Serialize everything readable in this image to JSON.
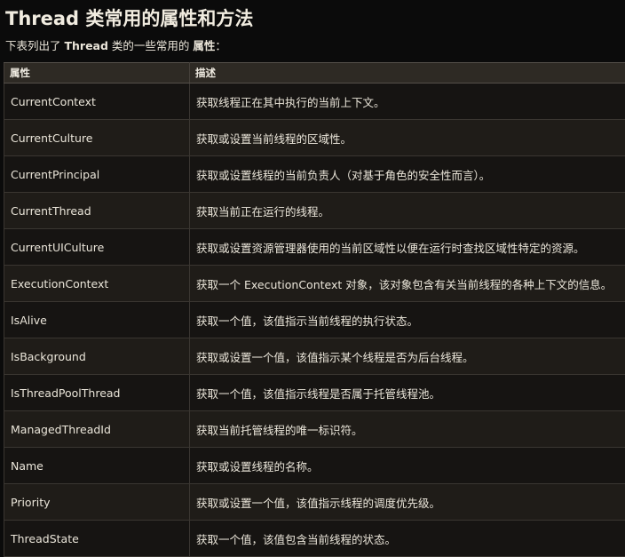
{
  "page": {
    "title": "Thread 类常用的属性和方法",
    "intro_prefix": "下表列出了 ",
    "intro_class": "Thread",
    "intro_middle": " 类的一些常用的 ",
    "intro_bold": "属性",
    "intro_suffix": "："
  },
  "table": {
    "headers": [
      "属性",
      "描述"
    ],
    "rows": [
      {
        "name": "CurrentContext",
        "desc": "获取线程正在其中执行的当前上下文。"
      },
      {
        "name": "CurrentCulture",
        "desc": "获取或设置当前线程的区域性。"
      },
      {
        "name": "CurrentPrincipal",
        "desc": "获取或设置线程的当前负责人（对基于角色的安全性而言）。"
      },
      {
        "name": "CurrentThread",
        "desc": "获取当前正在运行的线程。"
      },
      {
        "name": "CurrentUICulture",
        "desc": "获取或设置资源管理器使用的当前区域性以便在运行时查找区域性特定的资源。"
      },
      {
        "name": "ExecutionContext",
        "desc": "获取一个 ExecutionContext 对象，该对象包含有关当前线程的各种上下文的信息。"
      },
      {
        "name": "IsAlive",
        "desc": "获取一个值，该值指示当前线程的执行状态。"
      },
      {
        "name": "IsBackground",
        "desc": "获取或设置一个值，该值指示某个线程是否为后台线程。"
      },
      {
        "name": "IsThreadPoolThread",
        "desc": "获取一个值，该值指示线程是否属于托管线程池。"
      },
      {
        "name": "ManagedThreadId",
        "desc": "获取当前托管线程的唯一标识符。"
      },
      {
        "name": "Name",
        "desc": "获取或设置线程的名称。"
      },
      {
        "name": "Priority",
        "desc": "获取或设置一个值，该值指示线程的调度优先级。"
      },
      {
        "name": "ThreadState",
        "desc": "获取一个值，该值包含当前线程的状态。"
      }
    ]
  },
  "colors": {
    "background": "#0b0b0b",
    "header_bg": "#2e2a24",
    "row_odd_bg": "#161412",
    "row_even_bg": "#1f1c18",
    "text": "#ebe6da"
  }
}
